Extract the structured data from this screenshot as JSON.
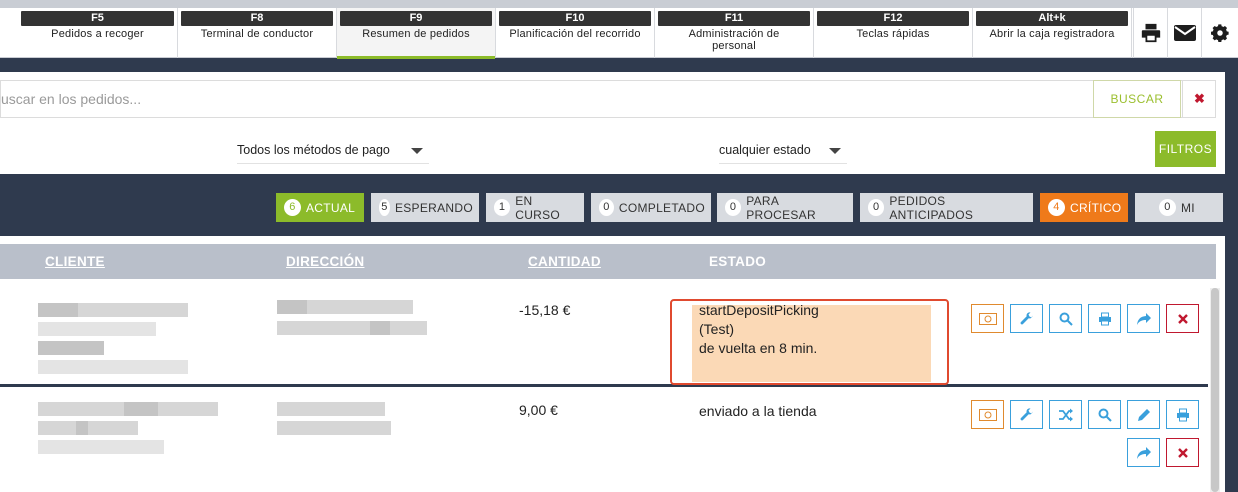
{
  "tabs": [
    {
      "key": "F5",
      "label": "Pedidos a recoger"
    },
    {
      "key": "F8",
      "label": "Terminal de conductor"
    },
    {
      "key": "F9",
      "label": "Resumen de pedidos"
    },
    {
      "key": "F10",
      "label": "Planificación del recorrido"
    },
    {
      "key": "F11",
      "label": "Administración de personal"
    },
    {
      "key": "F12",
      "label": "Teclas rápidas"
    },
    {
      "key": "Alt+k",
      "label": "Abrir la caja registradora"
    }
  ],
  "active_tab": "F9",
  "toolbar_icons": [
    "printer-icon",
    "envelope-icon",
    "gear-icon"
  ],
  "search": {
    "placeholder": "uscar en los pedidos...",
    "button": "BUSCAR",
    "clear": "✖"
  },
  "filters": {
    "payment_method": "Todos los métodos de pago",
    "state": "cualquier estado",
    "button": "FILTROS"
  },
  "status_chips": [
    {
      "count": "6",
      "label": "ACTUAL"
    },
    {
      "count": "5",
      "label": "ESPERANDO"
    },
    {
      "count": "1",
      "label": "EN CURSO"
    },
    {
      "count": "0",
      "label": "COMPLETADO"
    },
    {
      "count": "0",
      "label": "PARA PROCESAR"
    },
    {
      "count": "0",
      "label": "PEDIDOS ANTICIPADOS"
    },
    {
      "count": "4",
      "label": "CRÍTICO"
    },
    {
      "count": "0",
      "label": "MI"
    }
  ],
  "table": {
    "headers": {
      "client": "CLIENTE",
      "address": "DIRECCIÓN",
      "amount": "CANTIDAD",
      "state": "ESTADO"
    },
    "rows": [
      {
        "amount": "-15,18 €",
        "status_lines": [
          "startDepositPicking",
          "(Test)",
          "de vuelta en 8 min."
        ]
      },
      {
        "amount": "9,00 €",
        "status_lines": [
          "enviado a la tienda"
        ]
      }
    ]
  },
  "colors": {
    "accent_green": "#8cbb2a",
    "critical_orange": "#ef7a1a",
    "danger_red": "#c0182f",
    "action_blue": "#3aa0dc",
    "header_bg": "#b9bfca",
    "dark_bg": "#2f3a4e"
  }
}
